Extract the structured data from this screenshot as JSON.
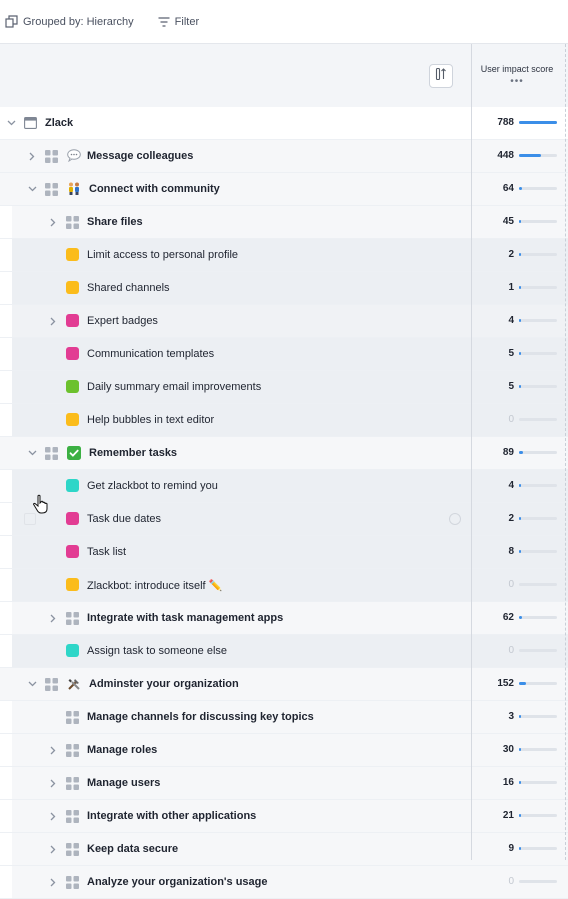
{
  "toolbar": {
    "group_label": "Grouped by: Hierarchy",
    "filter_label": "Filter"
  },
  "column": {
    "header": "User impact score",
    "menu": "•••"
  },
  "colors": {
    "accent_bar": "#3b8ee8",
    "yellow": "#fbbc1b",
    "magenta": "#e23c93",
    "green": "#6cc12d",
    "teal": "#2ed6c8"
  },
  "rows": [
    {
      "label": "Zlack",
      "score": "788",
      "fill": 1.0,
      "level": 0,
      "caret": "down",
      "icon": "product",
      "bold": true
    },
    {
      "label": "Message colleagues",
      "score": "448",
      "fill": 0.57,
      "level": 1,
      "caret": "right",
      "icon": "speech",
      "bold": true
    },
    {
      "label": "Connect with community",
      "score": "64",
      "fill": 0.08,
      "level": 1,
      "caret": "down",
      "icon": "people",
      "bold": true
    },
    {
      "label": "Share files",
      "score": "45",
      "fill": 0.06,
      "level": 2,
      "caret": "right",
      "icon": "grid",
      "bold": true
    },
    {
      "label": "Limit access to personal profile",
      "score": "2",
      "fill": 0.01,
      "level": 3,
      "icon": "yellow"
    },
    {
      "label": "Shared channels",
      "score": "1",
      "fill": 0.005,
      "level": 3,
      "icon": "yellow"
    },
    {
      "label": "Expert badges",
      "score": "4",
      "fill": 0.01,
      "level": 2,
      "caret": "right",
      "icon": "magenta"
    },
    {
      "label": "Communication templates",
      "score": "5",
      "fill": 0.01,
      "level": 3,
      "icon": "magenta"
    },
    {
      "label": "Daily summary email improvements",
      "score": "5",
      "fill": 0.01,
      "level": 3,
      "icon": "green"
    },
    {
      "label": "Help bubbles in text editor",
      "score": "0",
      "fill": 0,
      "level": 3,
      "icon": "yellow"
    },
    {
      "label": "Remember tasks",
      "score": "89",
      "fill": 0.11,
      "level": 1,
      "caret": "down",
      "icon": "check",
      "bold": true
    },
    {
      "label": "Get zlackbot to remind you",
      "score": "4",
      "fill": 0.01,
      "level": 3,
      "icon": "teal"
    },
    {
      "label": "Task due dates",
      "score": "2",
      "fill": 0.005,
      "level": 3,
      "icon": "magenta"
    },
    {
      "label": "Task list",
      "score": "8",
      "fill": 0.01,
      "level": 3,
      "icon": "magenta"
    },
    {
      "label": "Zlackbot: introduce itself ✏️",
      "score": "0",
      "fill": 0,
      "level": 3,
      "icon": "yellow"
    },
    {
      "label": "Integrate with task management apps",
      "score": "62",
      "fill": 0.08,
      "level": 2,
      "caret": "right",
      "icon": "grid",
      "bold": true
    },
    {
      "label": "Assign task to someone else",
      "score": "0",
      "fill": 0,
      "level": 3,
      "icon": "teal"
    },
    {
      "label": "Adminster your organization",
      "score": "152",
      "fill": 0.19,
      "level": 1,
      "caret": "down",
      "icon": "tools",
      "bold": true
    },
    {
      "label": "Manage channels for discussing key topics",
      "score": "3",
      "fill": 0.005,
      "level": 2,
      "icon": "grid",
      "bold": true
    },
    {
      "label": "Manage roles",
      "score": "30",
      "fill": 0.04,
      "level": 2,
      "caret": "right",
      "icon": "grid",
      "bold": true
    },
    {
      "label": "Manage users",
      "score": "16",
      "fill": 0.02,
      "level": 2,
      "caret": "right",
      "icon": "grid",
      "bold": true
    },
    {
      "label": "Integrate with other applications",
      "score": "21",
      "fill": 0.03,
      "level": 2,
      "caret": "right",
      "icon": "grid",
      "bold": true
    },
    {
      "label": "Keep data secure",
      "score": "9",
      "fill": 0.01,
      "level": 2,
      "caret": "right",
      "icon": "grid",
      "bold": true
    },
    {
      "label": "Analyze your organization's usage",
      "score": "0",
      "fill": 0,
      "level": 2,
      "caret": "right",
      "icon": "grid",
      "bold": true
    }
  ]
}
